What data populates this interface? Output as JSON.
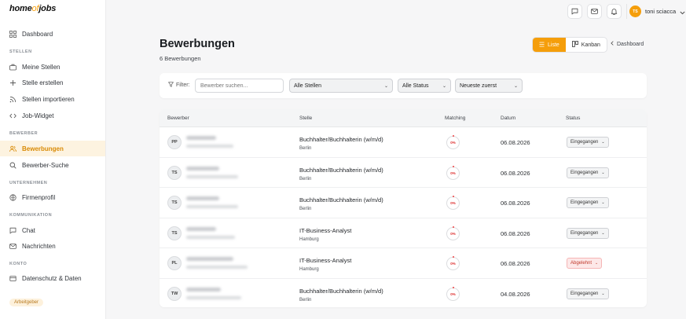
{
  "brand": {
    "logo_part1": "home",
    "logo_part2": "of",
    "logo_part3": "jobs"
  },
  "sidebar": {
    "dashboard": "Dashboard",
    "sections": [
      "STELLEN",
      "BEWERBER",
      "UNTERNEHMEN",
      "KOMMUNIKATION",
      "KONTO"
    ],
    "items": [
      {
        "label": "Meine Stellen",
        "icon": "briefcase-icon"
      },
      {
        "label": "Stelle erstellen",
        "icon": "plus-icon"
      },
      {
        "label": "Stellen importieren",
        "icon": "rss-icon"
      },
      {
        "label": "Job-Widget",
        "icon": "code-icon"
      },
      {
        "label": "Bewerbungen",
        "icon": "users-icon",
        "active": true
      },
      {
        "label": "Bewerber-Suche",
        "icon": "search-icon"
      },
      {
        "label": "Firmenprofil",
        "icon": "building-icon"
      },
      {
        "label": "Chat",
        "icon": "chat-icon"
      },
      {
        "label": "Nachrichten",
        "icon": "mail-icon"
      },
      {
        "label": "Datenschutz & Daten",
        "icon": "shield-icon"
      }
    ],
    "role_badge": "Arbeitgeber"
  },
  "topbar": {
    "user_initials": "TS",
    "user_name": "toni sciacca"
  },
  "header": {
    "title": "Bewerbungen",
    "subtitle": "6 Bewerbungen",
    "view_list": "Liste",
    "view_kanban": "Kanban",
    "back_link": "Dashboard"
  },
  "filters": {
    "label": "Filter:",
    "search_placeholder": "Bewerber suchen...",
    "job_select": "Alle Stellen",
    "status_select": "Alle Status",
    "sort_select": "Neueste zuerst"
  },
  "table": {
    "columns": [
      "Bewerber",
      "Stelle",
      "Matching",
      "Datum",
      "Status"
    ],
    "rows": [
      {
        "initials": "PP",
        "job": "Buchhalter/Buchhalterin (w/m/d)",
        "location": "Berlin",
        "match": "0%",
        "date": "06.08.2026",
        "status": "Eingegangen",
        "rejected": false
      },
      {
        "initials": "TS",
        "job": "Buchhalter/Buchhalterin (w/m/d)",
        "location": "Berlin",
        "match": "0%",
        "date": "06.08.2026",
        "status": "Eingegangen",
        "rejected": false
      },
      {
        "initials": "TS",
        "job": "Buchhalter/Buchhalterin (w/m/d)",
        "location": "Berlin",
        "match": "0%",
        "date": "06.08.2026",
        "status": "Eingegangen",
        "rejected": false
      },
      {
        "initials": "TS",
        "job": "IT-Business-Analyst",
        "location": "Hamburg",
        "match": "0%",
        "date": "06.08.2026",
        "status": "Eingegangen",
        "rejected": false
      },
      {
        "initials": "PL",
        "job": "IT-Business-Analyst",
        "location": "Hamburg",
        "match": "0%",
        "date": "06.08.2026",
        "status": "Abgelehnt",
        "rejected": true
      },
      {
        "initials": "TW",
        "job": "Buchhalter/Buchhalterin (w/m/d)",
        "location": "Berlin",
        "match": "0%",
        "date": "04.08.2026",
        "status": "Eingegangen",
        "rejected": false
      }
    ]
  },
  "colors": {
    "accent": "#f59e0b",
    "danger": "#dc2626"
  }
}
